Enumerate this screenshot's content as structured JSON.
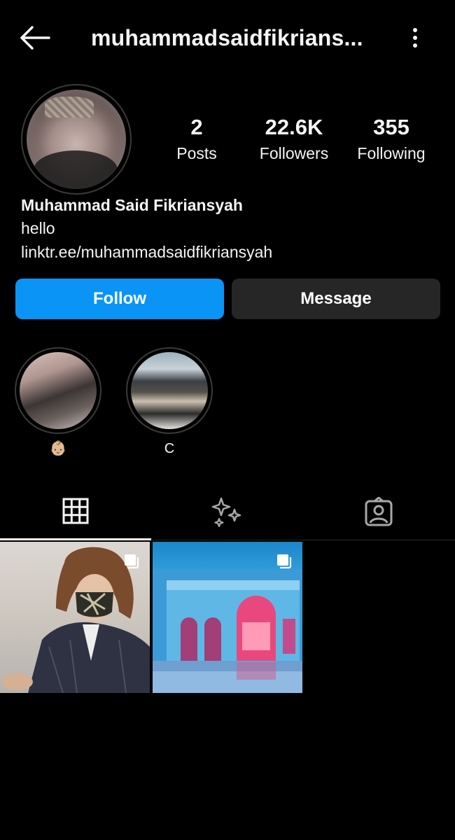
{
  "header": {
    "username": "muhammadsaidfikrians..."
  },
  "profile": {
    "stats": {
      "posts_count": "2",
      "posts_label": "Posts",
      "followers_count": "22.6K",
      "followers_label": "Followers",
      "following_count": "355",
      "following_label": "Following"
    },
    "full_name": "Muhammad Said Fikriansyah",
    "bio": "hello",
    "link": "linktr.ee/muhammadsaidfikriansyah"
  },
  "actions": {
    "follow_label": "Follow",
    "message_label": "Message",
    "follow_color": "#0a95f6",
    "message_color": "#262626"
  },
  "highlights": [
    {
      "caption": "👶🏼"
    },
    {
      "caption": "C"
    }
  ],
  "tabs": [
    {
      "icon": "grid-icon",
      "selected": true
    },
    {
      "icon": "reels-sparkle-icon",
      "selected": false
    },
    {
      "icon": "tagged-icon",
      "selected": false
    }
  ],
  "posts": [
    {
      "icon": "multiple-posts-icon"
    },
    {
      "icon": "multiple-posts-icon"
    }
  ]
}
